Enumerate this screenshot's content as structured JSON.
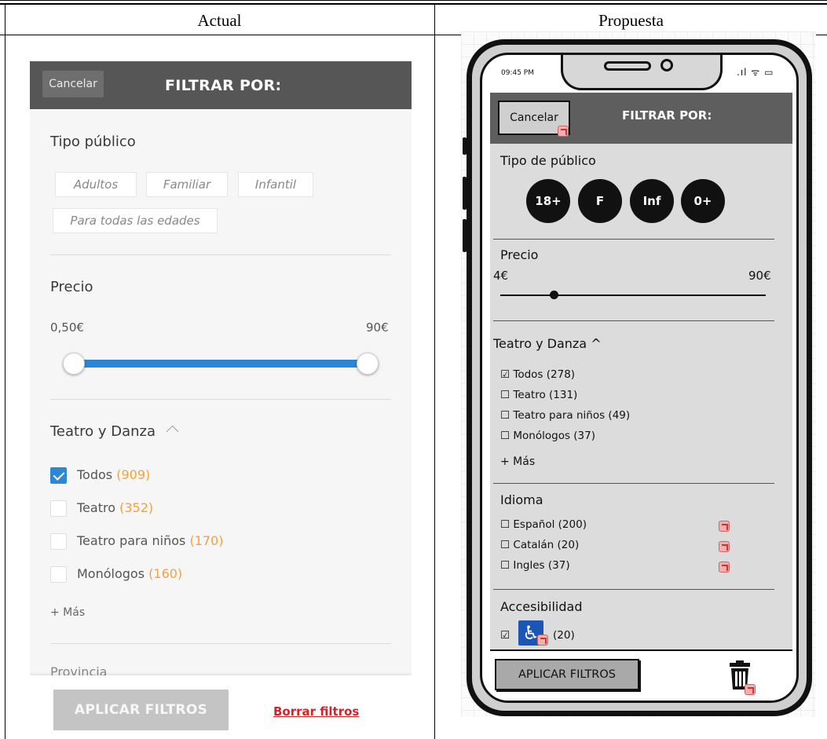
{
  "columns": {
    "actual": "Actual",
    "proposed": "Propuesta"
  },
  "actual": {
    "header": {
      "cancel_label": "Cancelar",
      "title": "FILTRAR POR:"
    },
    "audience": {
      "title": "Tipo público",
      "options": [
        "Adultos",
        "Familiar",
        "Infantil",
        "Para todas las edades"
      ]
    },
    "price": {
      "title": "Precio",
      "min": "0,50€",
      "max": "90€"
    },
    "category": {
      "title": "Teatro y Danza",
      "items": [
        {
          "label": "Todos",
          "count": "(909)",
          "checked": true
        },
        {
          "label": "Teatro",
          "count": "(352)",
          "checked": false
        },
        {
          "label": "Teatro para niños",
          "count": "(170)",
          "checked": false
        },
        {
          "label": "Monólogos",
          "count": "(160)",
          "checked": false
        }
      ],
      "more_label": "+ Más"
    },
    "next_section": "Provincia",
    "footer": {
      "apply_label": "APLICAR FILTROS",
      "clear_label": "Borrar filtros"
    },
    "colors": {
      "header": "#565656",
      "slider": "#2c86d6",
      "count": "#f5a13c",
      "clear_link": "#d2232a"
    }
  },
  "proposed": {
    "status_bar": {
      "time": "09:45 PM",
      "icons": "signal-wifi-battery-icons"
    },
    "header": {
      "cancel_label": "Cancelar",
      "title": "FILTRAR POR:"
    },
    "audience": {
      "title": "Tipo de público",
      "options": [
        "18+",
        "F",
        "Inf",
        "0+"
      ]
    },
    "price": {
      "title": "Precio",
      "min": "4€",
      "max": "90€"
    },
    "category": {
      "title": "Teatro y Danza ^",
      "items": [
        "☑ Todos (278)",
        "☐ Teatro (131)",
        "☐ Teatro para niños (49)",
        "☐ Monólogos (37)"
      ],
      "more_label": "+ Más"
    },
    "language": {
      "title": "Idioma",
      "items": [
        "☐ Español (200)",
        "☐ Catalán (20)",
        "☐ Ingles (37)"
      ]
    },
    "accessibility": {
      "title": "Accesibilidad",
      "checkbox": "☑",
      "count": "(20)",
      "icon": "wheelchair-icon"
    },
    "footer": {
      "apply_label": "APLICAR FILTROS",
      "delete_icon": "trash-icon"
    }
  }
}
